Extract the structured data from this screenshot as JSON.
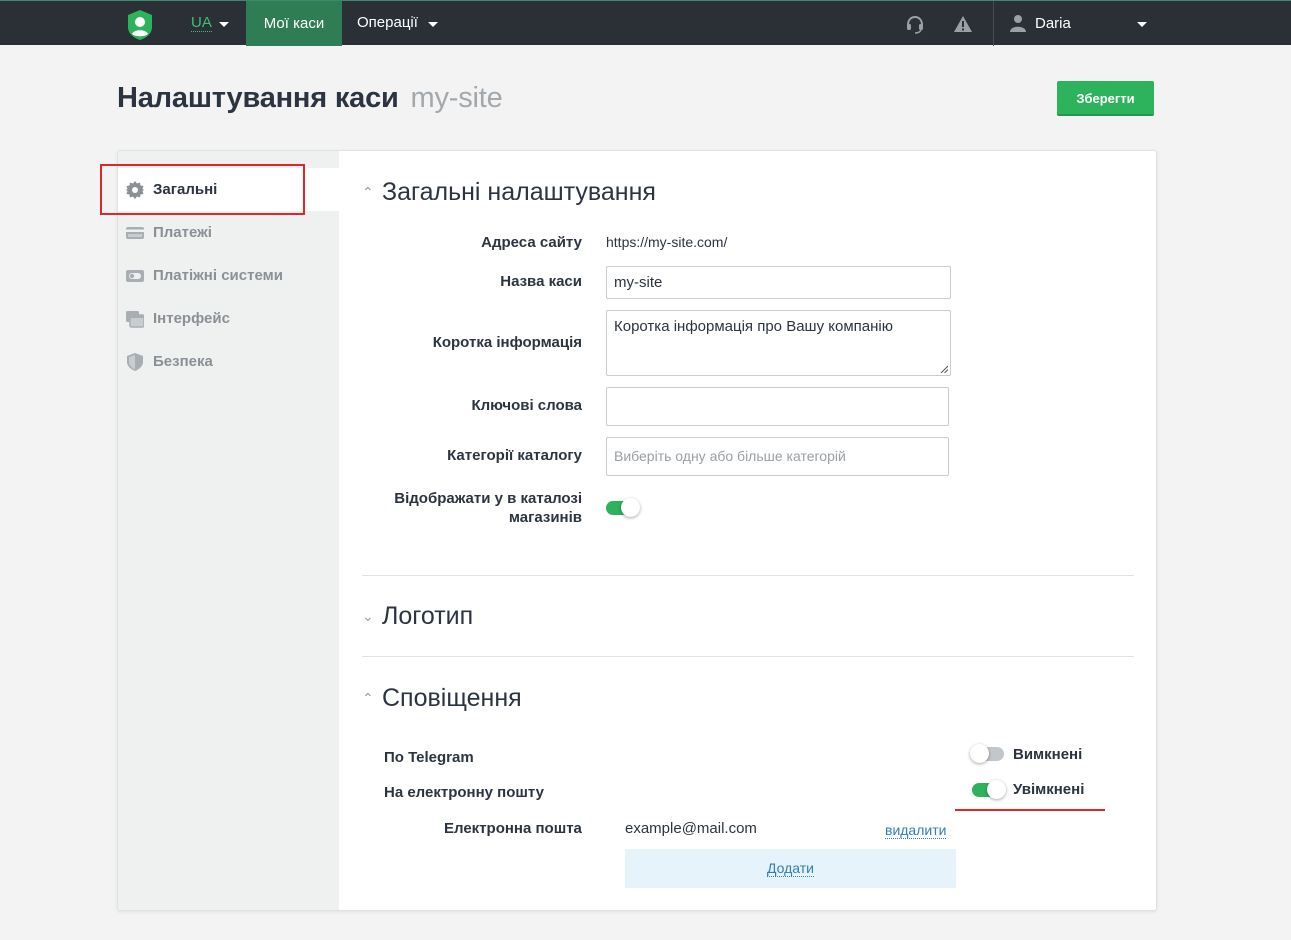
{
  "topbar": {
    "lang": "UA",
    "nav_my_stores": "Мої каси",
    "nav_operations": "Операції",
    "user_name": "Daria"
  },
  "header": {
    "title": "Налаштування каси",
    "subtitle": "my-site",
    "save_label": "Зберегти"
  },
  "sidebar": {
    "items": [
      {
        "label": "Загальні",
        "icon": "gear-icon",
        "active": true
      },
      {
        "label": "Платежі",
        "icon": "card-icon"
      },
      {
        "label": "Платіжні системи",
        "icon": "toggle-card-icon"
      },
      {
        "label": "Інтерфейс",
        "icon": "window-icon"
      },
      {
        "label": "Безпека",
        "icon": "shield-icon"
      }
    ]
  },
  "general": {
    "heading": "Загальні налаштування",
    "site_address_label": "Адреса сайту",
    "site_address_value": "https://my-site.com/",
    "store_name_label": "Назва каси",
    "store_name_value": "my-site",
    "short_info_label": "Коротка інформація",
    "short_info_placeholder": "Коротка інформація про Вашу компанію",
    "keywords_label": "Ключові слова",
    "keywords_value": "",
    "catalog_categories_label": "Категорії каталогу",
    "catalog_categories_placeholder": "Виберіть одну або більше категорій",
    "show_in_catalog_label_line1": "Відображати у в каталозі",
    "show_in_catalog_label_line2": "магазинів",
    "show_in_catalog_on": true
  },
  "logo": {
    "heading": "Логотип"
  },
  "notifications": {
    "heading": "Сповіщення",
    "telegram_label": "По Telegram",
    "telegram_status": "Вимкнені",
    "telegram_on": false,
    "email_label": "На електронну пошту",
    "email_status": "Увімкнені",
    "email_on": true,
    "email_field_label": "Електронна пошта",
    "email_value": "example@mail.com",
    "delete_label": "видалити",
    "add_label": "Додати"
  },
  "colors": {
    "accent_green": "#2db35b",
    "nav_bg": "#2b2f36",
    "highlight_red": "#e0262b",
    "link_blue": "#2f7fb5"
  }
}
